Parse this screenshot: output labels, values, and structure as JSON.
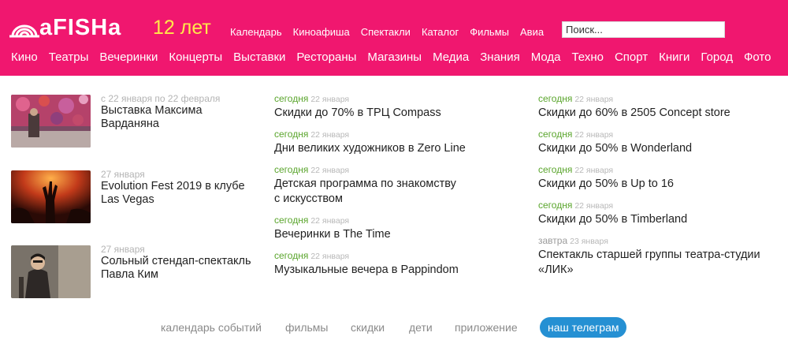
{
  "header": {
    "logo_text": "aFISHa",
    "anniversary": "12 лет",
    "top_nav": [
      "Календарь",
      "Киноафиша",
      "Спектакли",
      "Каталог",
      "Фильмы",
      "Авиа"
    ],
    "search_placeholder": "Поиск...",
    "main_nav": [
      "Кино",
      "Театры",
      "Вечеринки",
      "Концерты",
      "Выставки",
      "Рестораны",
      "Магазины",
      "Медиа",
      "Знания",
      "Мода",
      "Техно",
      "Спорт",
      "Книги",
      "Город",
      "Фото"
    ]
  },
  "featured": [
    {
      "meta": "с 22 января по 22 февраля",
      "title": "Выставка Максима Варданяна",
      "image": "exhibition-photo"
    },
    {
      "meta": "27 января",
      "title": "Evolution Fest 2019 в клубе Las Vegas",
      "image": "concert-photo"
    },
    {
      "meta": "27 января",
      "title": "Сольный стендап-спектакль Павла Ким",
      "image": "comedian-photo"
    }
  ],
  "column2": [
    {
      "rel": "сегодня",
      "abs": "22 января",
      "title": "Скидки до 70% в ТРЦ Compass"
    },
    {
      "rel": "сегодня",
      "abs": "22 января",
      "title": "Дни великих художников в Zero Line"
    },
    {
      "rel": "сегодня",
      "abs": "22 января",
      "title": "Детская программа по знакомству с искусством"
    },
    {
      "rel": "сегодня",
      "abs": "22 января",
      "title": "Вечеринки в The Time"
    },
    {
      "rel": "сегодня",
      "abs": "22 января",
      "title": "Музыкальные вечера в Pappindom"
    }
  ],
  "column3": [
    {
      "rel": "сегодня",
      "abs": "22 января",
      "title": "Скидки до 60% в 2505 Concept store"
    },
    {
      "rel": "сегодня",
      "abs": "22 января",
      "title": "Скидки до 50% в Wonderland"
    },
    {
      "rel": "сегодня",
      "abs": "22 января",
      "title": "Скидки до 50% в Up to 16"
    },
    {
      "rel": "сегодня",
      "abs": "22 января",
      "title": "Скидки до 50% в Timberland"
    },
    {
      "rel": "завтра",
      "abs": "23 января",
      "title": "Спектакль старшей группы театра-студии «ЛИК»"
    }
  ],
  "footer": {
    "calendar": "календарь событий",
    "films": "фильмы",
    "discounts": "скидки",
    "kids": "дети",
    "app": "приложение",
    "telegram": "наш телеграм"
  },
  "colors": {
    "brand": "#f0176f",
    "anniversary": "#ffe94a",
    "today": "#5aa52c",
    "telegram": "#2590d3"
  }
}
